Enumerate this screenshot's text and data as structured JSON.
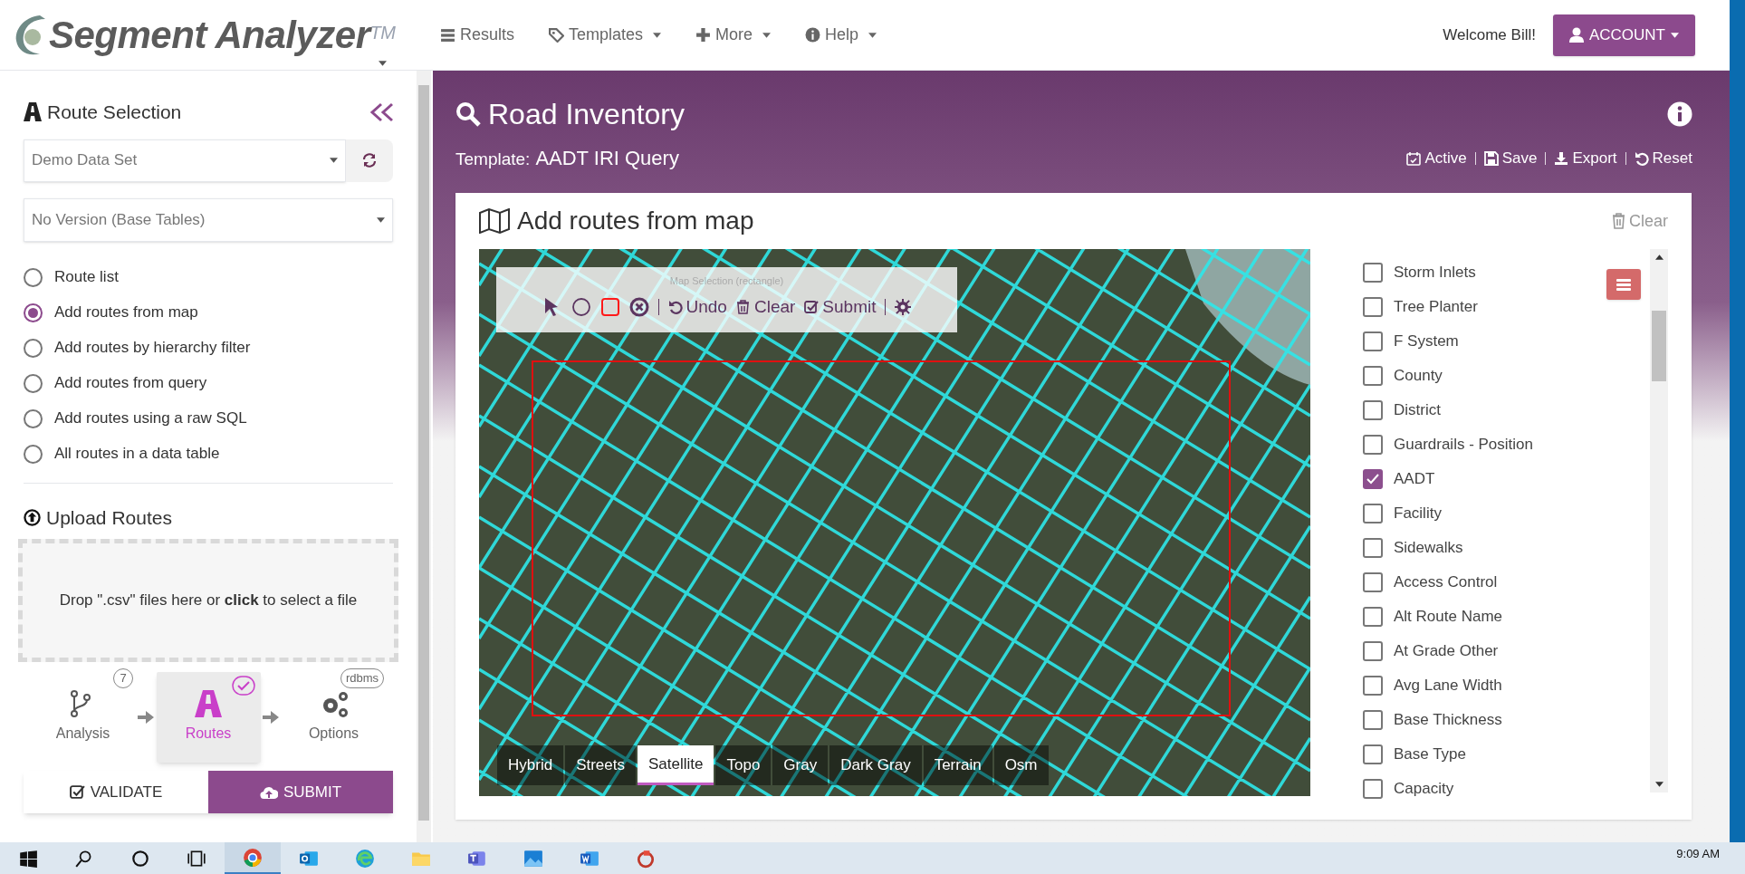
{
  "app": {
    "logo": "Segment Analyzer$^{TM}$"
  },
  "nav": [
    {
      "label": "Results",
      "dropdown": false
    },
    {
      "label": "Templates",
      "dropdown": true
    },
    {
      "label": "More",
      "dropdown": true
    },
    {
      "label": "Help",
      "dropdown": true
    }
  ],
  "user": {
    "welcome": "Welcome Bill!",
    "account_button": "ACCOUNT"
  },
  "sidebar": {
    "title": "Route Selection",
    "dataset_select": "Demo Data Set",
    "version_select": "No Version (Base Tables)",
    "route_options": [
      {
        "label": "Route list",
        "selected": false
      },
      {
        "label": "Add routes from map",
        "selected": true
      },
      {
        "label": "Add routes by hierarchy filter",
        "selected": false
      },
      {
        "label": "Add routes from query",
        "selected": false
      },
      {
        "label": "Add routes using a raw SQL",
        "selected": false
      },
      {
        "label": "All routes in a data table",
        "selected": false
      }
    ],
    "upload_title": "Upload Routes",
    "drop_text": "Drop \".csv\" files here or **click** to select a file",
    "steps": [
      {
        "label": "Analysis",
        "badge": "7",
        "selected": false
      },
      {
        "label": "Routes",
        "selected": true
      },
      {
        "label": "Options",
        "badge": "rdbms",
        "selected": false
      }
    ],
    "buttons": [
      "VALIDATE",
      "SUBMIT"
    ]
  },
  "banner": {
    "title": "Road Inventory",
    "template_label": "Template:",
    "template_name": "AADT IRI Query",
    "actions": [
      "Active",
      "Save",
      "Export",
      "Reset"
    ]
  },
  "card": {
    "title": "Add routes from map",
    "clear_button": "Clear",
    "map": {
      "toolbar_title": "Map Selection (rectangle)",
      "tools": [
        {
          "selected": false
        },
        {
          "selected": false
        },
        {
          "selected": true
        },
        {
          "selected": false
        }
      ],
      "actions": [
        "Undo",
        "Clear",
        "Submit"
      ],
      "basemaps": [
        {
          "label": "Hybrid",
          "selected": false
        },
        {
          "label": "Streets",
          "selected": false
        },
        {
          "label": "Satellite",
          "selected": true
        },
        {
          "label": "Topo",
          "selected": false
        },
        {
          "label": "Gray",
          "selected": false
        },
        {
          "label": "Dark Gray",
          "selected": false
        },
        {
          "label": "Terrain",
          "selected": false
        },
        {
          "label": "Osm",
          "selected": false
        }
      ]
    },
    "layers": [
      {
        "label": "Storm Inlets",
        "checked": false
      },
      {
        "label": "Tree Planter",
        "checked": false
      },
      {
        "label": "F System",
        "checked": false
      },
      {
        "label": "County",
        "checked": false
      },
      {
        "label": "District",
        "checked": false
      },
      {
        "label": "Guardrails - Position",
        "checked": false
      },
      {
        "label": "AADT",
        "checked": true
      },
      {
        "label": "Facility",
        "checked": false
      },
      {
        "label": "Sidewalks",
        "checked": false
      },
      {
        "label": "Access Control",
        "checked": false
      },
      {
        "label": "Alt Route Name",
        "checked": false
      },
      {
        "label": "At Grade Other",
        "checked": false
      },
      {
        "label": "Avg Lane Width",
        "checked": false
      },
      {
        "label": "Base Thickness",
        "checked": false
      },
      {
        "label": "Base Type",
        "checked": false
      },
      {
        "label": "Capacity",
        "checked": false
      }
    ]
  },
  "taskbar": {
    "time": "9:09 AM"
  }
}
